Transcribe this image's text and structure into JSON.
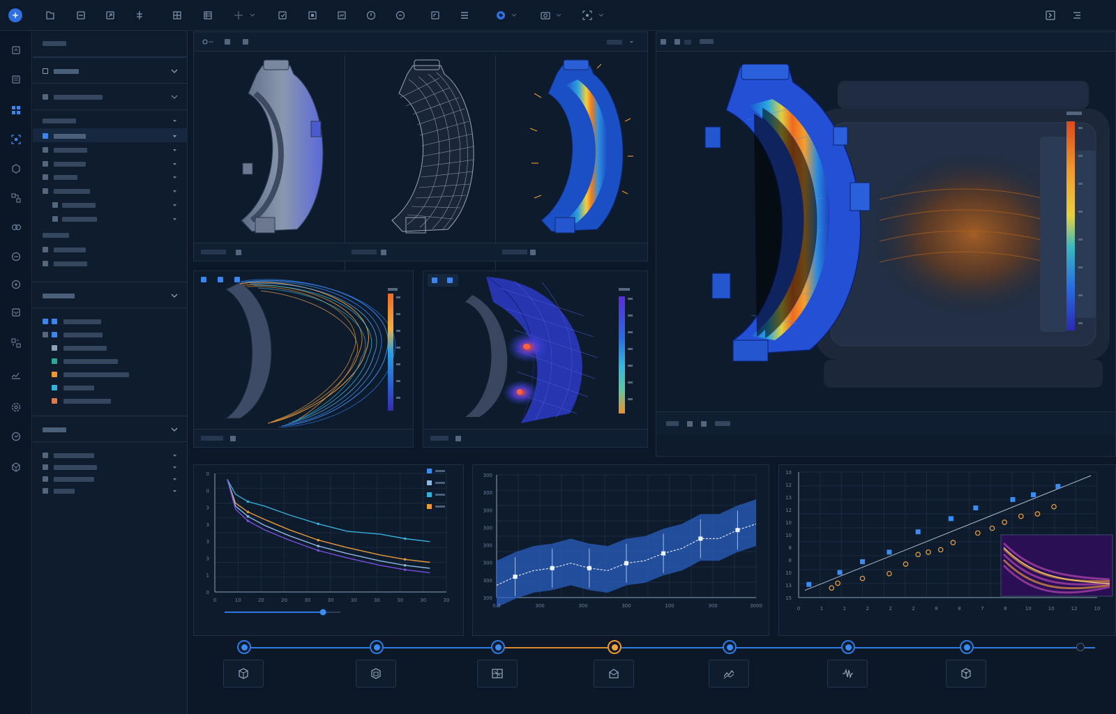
{
  "toolbar": {
    "icons": [
      "app-logo-icon",
      "open-file-icon",
      "save-icon",
      "import-icon",
      "export-icon",
      "mesh-icon",
      "table-icon",
      "transform-icon",
      "load-icon",
      "constraint-icon",
      "view-icon",
      "info-icon",
      "render-icon",
      "report-icon",
      "list-icon",
      "globe-icon",
      "camera-icon",
      "screenshot-icon",
      "terminal-icon",
      "menu-icon"
    ]
  },
  "rail": {
    "icons": [
      "model-icon",
      "layers-icon",
      "dashboard-icon",
      "mesh-select-icon",
      "physics-icon",
      "boundary-icon",
      "solver-icon",
      "results-icon",
      "probe-icon",
      "chart-icon",
      "compare-icon",
      "plot-icon",
      "settings-icon",
      "help-icon",
      "package-icon"
    ],
    "active_index": 2
  },
  "colors": {
    "accent_blue": "#2f7be3",
    "accent_orange": "#f0962e",
    "series_blue": "#3a8cf0",
    "series_light": "#8fb8e0",
    "series_cyan": "#35b0d8",
    "series_orange": "#e89a3c",
    "series_purple": "#7a4fe0",
    "teal": "#2aa79a"
  },
  "chart_data": [
    {
      "type": "line",
      "xlabel": "",
      "ylabel": "",
      "x_ticks": [
        "0",
        "10",
        "20",
        "20",
        "30",
        "30",
        "30",
        "30",
        "30",
        "30",
        "30"
      ],
      "y_ticks": [
        "0",
        "1",
        "3",
        "3",
        "3",
        "3",
        "0",
        "0"
      ],
      "series": [
        {
          "values": [
            [
              3,
              3.8
            ],
            [
              5,
              3.3
            ],
            [
              8,
              3.05
            ],
            [
              12,
              2.9
            ],
            [
              18,
              2.6
            ],
            [
              25,
              2.3
            ],
            [
              32,
              2.05
            ],
            [
              40,
              1.95
            ],
            [
              46,
              1.8
            ],
            [
              52,
              1.7
            ]
          ]
        },
        {
          "values": [
            [
              3,
              3.8
            ],
            [
              5,
              3.0
            ],
            [
              8,
              2.7
            ],
            [
              12,
              2.45
            ],
            [
              18,
              2.1
            ],
            [
              25,
              1.75
            ],
            [
              32,
              1.5
            ],
            [
              40,
              1.25
            ],
            [
              46,
              1.1
            ],
            [
              52,
              1.0
            ]
          ]
        },
        {
          "values": [
            [
              3,
              3.8
            ],
            [
              5,
              2.9
            ],
            [
              8,
              2.55
            ],
            [
              12,
              2.25
            ],
            [
              18,
              1.9
            ],
            [
              25,
              1.55
            ],
            [
              32,
              1.3
            ],
            [
              40,
              1.05
            ],
            [
              46,
              0.9
            ],
            [
              52,
              0.8
            ]
          ]
        },
        {
          "values": [
            [
              3,
              3.8
            ],
            [
              5,
              2.8
            ],
            [
              8,
              2.4
            ],
            [
              12,
              2.1
            ],
            [
              18,
              1.75
            ],
            [
              25,
              1.4
            ],
            [
              32,
              1.15
            ],
            [
              40,
              0.9
            ],
            [
              46,
              0.75
            ],
            [
              52,
              0.65
            ]
          ]
        }
      ],
      "slider_value": 0.85
    },
    {
      "type": "line",
      "xlabel": "",
      "ylabel": "",
      "x_ticks": [
        "0.0",
        "300",
        "300",
        "300",
        "100",
        "300",
        "3000"
      ],
      "y_ticks": [
        "300",
        "300",
        "300",
        "300",
        "300",
        "300",
        "300",
        "300"
      ],
      "series": [
        {
          "values": [
            [
              0,
              0.9
            ],
            [
              1,
              0.83
            ],
            [
              2,
              0.78
            ],
            [
              3,
              0.76
            ],
            [
              4,
              0.72
            ],
            [
              5,
              0.76
            ],
            [
              6,
              0.78
            ],
            [
              7,
              0.72
            ],
            [
              8,
              0.7
            ],
            [
              9,
              0.64
            ],
            [
              10,
              0.6
            ],
            [
              11,
              0.52
            ],
            [
              12,
              0.52
            ],
            [
              13,
              0.45
            ],
            [
              14,
              0.4
            ]
          ]
        }
      ]
    },
    {
      "type": "scatter",
      "xlabel": "",
      "ylabel": "",
      "x_ticks": [
        "0",
        "1",
        "1",
        "2",
        "2",
        "2",
        "8",
        "8",
        "7",
        "8",
        "10",
        "10",
        "12",
        "10"
      ],
      "y_ticks": [
        "10",
        "12",
        "13",
        "12",
        "10",
        "10",
        "8",
        "8",
        "10",
        "13",
        "15"
      ],
      "series": [
        {
          "values": [
            [
              0.5,
              1.1
            ],
            [
              2.0,
              2.1
            ],
            [
              3.1,
              3.0
            ],
            [
              4.4,
              3.8
            ],
            [
              5.8,
              5.5
            ],
            [
              7.4,
              6.6
            ],
            [
              8.6,
              7.5
            ],
            [
              10.4,
              8.2
            ],
            [
              11.4,
              8.6
            ],
            [
              12.6,
              9.3
            ]
          ]
        },
        {
          "values": [
            [
              1.6,
              0.8
            ],
            [
              1.9,
              1.2
            ],
            [
              3.1,
              1.6
            ],
            [
              4.4,
              2.0
            ],
            [
              5.2,
              2.8
            ],
            [
              5.8,
              3.6
            ],
            [
              6.3,
              3.8
            ],
            [
              6.9,
              4.0
            ],
            [
              7.5,
              4.6
            ],
            [
              8.7,
              5.4
            ],
            [
              9.4,
              5.8
            ],
            [
              10.0,
              6.3
            ],
            [
              10.8,
              6.8
            ],
            [
              11.6,
              7.0
            ],
            [
              12.4,
              7.6
            ]
          ]
        }
      ],
      "fit": [
        [
          0.3,
          0.6
        ],
        [
          14.2,
          10.2
        ]
      ]
    }
  ],
  "timeline": {
    "nodes": 8,
    "orange_index": 3,
    "tools": [
      "cube-icon",
      "structure-icon",
      "mesh-grid-icon",
      "mail-box-icon",
      "trend-icon",
      "waveform-icon",
      "box-3d-icon"
    ]
  }
}
